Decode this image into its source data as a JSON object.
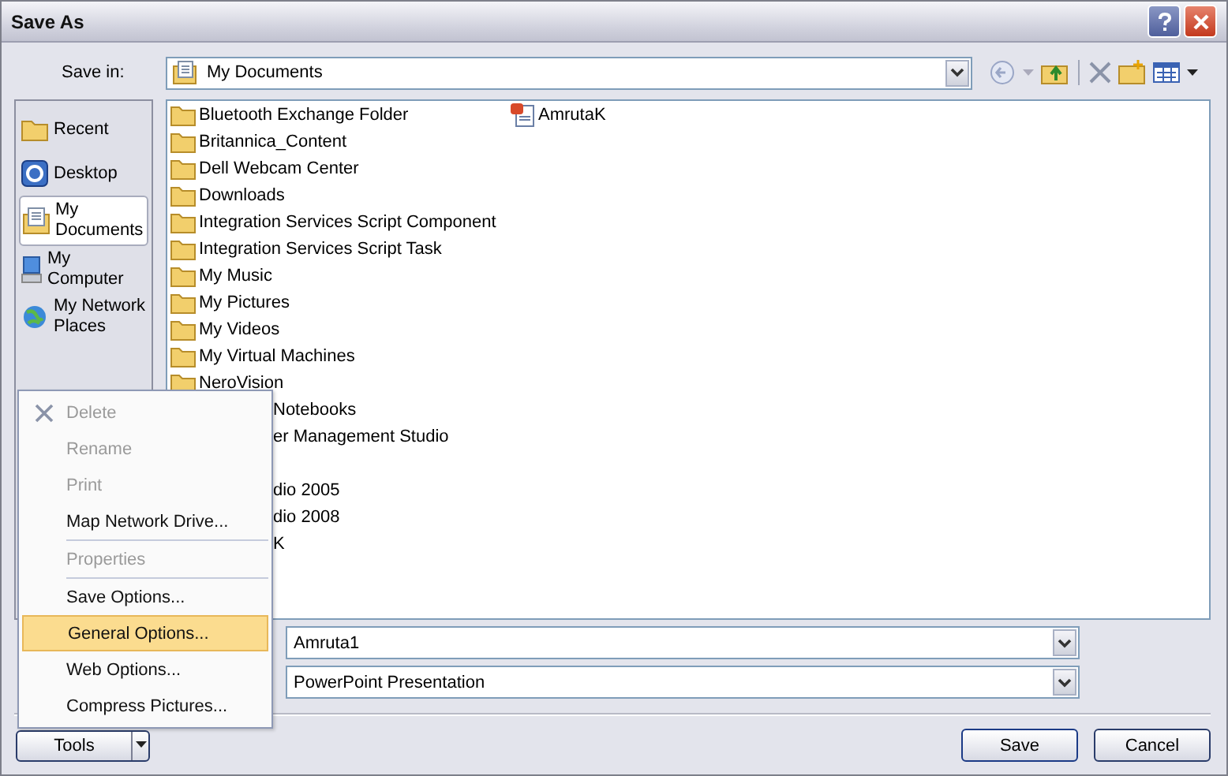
{
  "window": {
    "title": "Save As"
  },
  "save_in": {
    "label": "Save in:",
    "value": "My Documents"
  },
  "places": [
    {
      "label": "Recent",
      "kind": "folder",
      "selected": false
    },
    {
      "label": "Desktop",
      "kind": "desktop",
      "selected": false
    },
    {
      "label": "My Documents",
      "kind": "documents",
      "selected": true
    },
    {
      "label": "My Computer",
      "kind": "computer",
      "selected": false
    },
    {
      "label": "My Network Places",
      "kind": "network",
      "selected": false
    }
  ],
  "files": [
    {
      "name": "Bluetooth Exchange Folder",
      "kind": "folder"
    },
    {
      "name": "Britannica_Content",
      "kind": "folder"
    },
    {
      "name": "Dell Webcam Center",
      "kind": "folder"
    },
    {
      "name": "Downloads",
      "kind": "folder"
    },
    {
      "name": "Integration Services Script Component",
      "kind": "folder"
    },
    {
      "name": "Integration Services Script Task",
      "kind": "folder"
    },
    {
      "name": "My Music",
      "kind": "folder"
    },
    {
      "name": "My Pictures",
      "kind": "folder"
    },
    {
      "name": "My Videos",
      "kind": "folder"
    },
    {
      "name": "My Virtual Machines",
      "kind": "folder"
    },
    {
      "name": "NeroVision",
      "kind": "folder"
    },
    {
      "name": "Notebooks",
      "kind": "partial"
    },
    {
      "name": "er Management Studio",
      "kind": "partial"
    },
    {
      "kind": "blank"
    },
    {
      "name": "dio 2005",
      "kind": "partial"
    },
    {
      "name": "dio 2008",
      "kind": "partial"
    },
    {
      "name": "K",
      "kind": "partial"
    },
    {
      "name": "AmrutaK",
      "kind": "presentation"
    }
  ],
  "file_name": {
    "value": "Amruta1"
  },
  "save_as_type": {
    "value": "PowerPoint Presentation"
  },
  "tools_menu": [
    {
      "label": "Delete",
      "disabled": true,
      "kind": "delete",
      "selected": false,
      "separator_after": false
    },
    {
      "label": "Rename",
      "disabled": true,
      "selected": false,
      "separator_after": false
    },
    {
      "label": "Print",
      "disabled": true,
      "selected": false,
      "separator_after": false
    },
    {
      "label": "Map Network Drive...",
      "disabled": false,
      "selected": false,
      "separator_after": true
    },
    {
      "label": "Properties",
      "disabled": true,
      "selected": false,
      "separator_after": true
    },
    {
      "label": "Save Options...",
      "disabled": false,
      "selected": false,
      "separator_after": false
    },
    {
      "label": "General Options...",
      "disabled": false,
      "selected": true,
      "separator_after": false
    },
    {
      "label": "Web Options...",
      "disabled": false,
      "selected": false,
      "separator_after": false
    },
    {
      "label": "Compress Pictures...",
      "disabled": false,
      "selected": false,
      "separator_after": false
    }
  ],
  "buttons": {
    "tools": "Tools",
    "save": "Save",
    "cancel": "Cancel"
  }
}
